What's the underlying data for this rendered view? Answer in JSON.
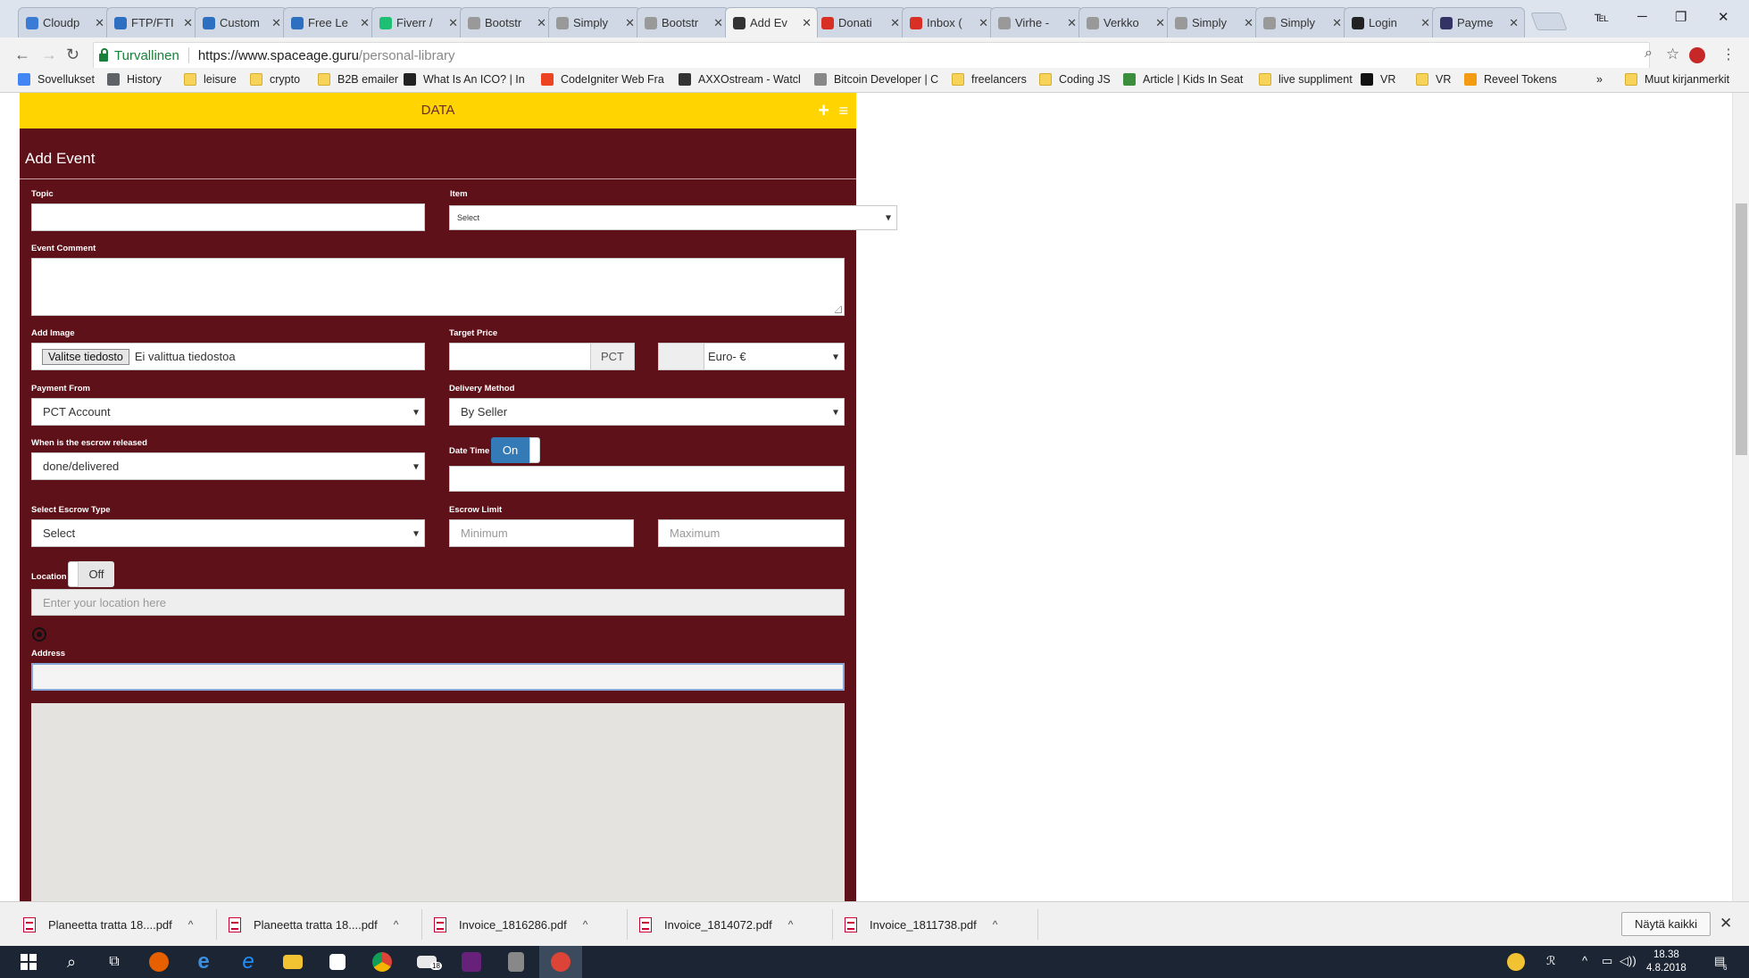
{
  "browser": {
    "tabs": [
      {
        "label": "Cloudp",
        "icon": "cloud-icon",
        "color": "#3a7bd5"
      },
      {
        "label": "FTP/FTI",
        "icon": "filezilla-icon",
        "color": "#2d6fc0"
      },
      {
        "label": "Custom",
        "icon": "filezilla-icon",
        "color": "#2d6fc0"
      },
      {
        "label": "Free Le",
        "icon": "filezilla-icon",
        "color": "#2d6fc0"
      },
      {
        "label": "Fiverr /",
        "icon": "fiverr-icon",
        "color": "#1dbf73"
      },
      {
        "label": "Bootstr",
        "icon": "page-icon",
        "color": "#999999"
      },
      {
        "label": "Simply",
        "icon": "page-icon",
        "color": "#999999"
      },
      {
        "label": "Bootstr",
        "icon": "page-icon",
        "color": "#999999"
      },
      {
        "label": "Add Ev",
        "icon": "site-icon",
        "color": "#333333",
        "active": true
      },
      {
        "label": "Donati",
        "icon": "gmail-icon",
        "color": "#d93025"
      },
      {
        "label": "Inbox (",
        "icon": "gmail-icon",
        "color": "#d93025"
      },
      {
        "label": "Virhe -",
        "icon": "page-icon",
        "color": "#999999"
      },
      {
        "label": "Verkko",
        "icon": "page-icon",
        "color": "#999999"
      },
      {
        "label": "Simply",
        "icon": "page-icon",
        "color": "#999999"
      },
      {
        "label": "Simply",
        "icon": "page-icon",
        "color": "#999999"
      },
      {
        "label": "Login",
        "icon": "github-icon",
        "color": "#222222"
      },
      {
        "label": "Payme",
        "icon": "payment-icon",
        "color": "#333366"
      }
    ],
    "secure_label": "Turvallinen",
    "url_host": "https://www.spaceage.guru",
    "url_path": "/personal-library",
    "bookmarks": [
      {
        "label": "Sovellukset",
        "icon": "apps-icon"
      },
      {
        "label": "History",
        "icon": "history-icon"
      },
      {
        "label": "leisure",
        "icon": "folder-icon"
      },
      {
        "label": "crypto",
        "icon": "folder-icon"
      },
      {
        "label": "B2B emailer",
        "icon": "folder-icon"
      },
      {
        "label": "What Is An ICO? | In",
        "icon": "info-icon"
      },
      {
        "label": "CodeIgniter Web Fra",
        "icon": "codeigniter-icon"
      },
      {
        "label": "AXXOstream - Watcl",
        "icon": "video-icon"
      },
      {
        "label": "Bitcoin Developer | C",
        "icon": "bitcoin-icon"
      },
      {
        "label": "freelancers",
        "icon": "folder-icon"
      },
      {
        "label": "Coding JS",
        "icon": "folder-icon"
      },
      {
        "label": "Article | Kids In Seat",
        "icon": "kids-icon"
      },
      {
        "label": "live suppliment",
        "icon": "folder-icon"
      },
      {
        "label": "VR",
        "icon": "vr-icon"
      },
      {
        "label": "VR",
        "icon": "folder-icon"
      },
      {
        "label": "Reveel Tokens",
        "icon": "reveel-icon"
      }
    ],
    "more_bookmarks": "»",
    "other_bookmarks": "Muut kirjanmerkit"
  },
  "page": {
    "header_title": "DATA",
    "form_title": "Add Event",
    "labels": {
      "topic": "Topic",
      "item": "Item",
      "event_comment": "Event Comment",
      "add_image": "Add Image",
      "target_price": "Target Price",
      "payment_from": "Payment From",
      "delivery_method": "Delivery Method",
      "escrow_release": "When is the escrow released",
      "date_time": "Date Time",
      "escrow_type": "Select Escrow Type",
      "escrow_limit": "Escrow Limit",
      "location": "Location",
      "address": "Address"
    },
    "values": {
      "topic": "",
      "item": "Select",
      "event_comment": "",
      "file_button": "Valitse tiedosto",
      "file_status": "Ei valittua tiedostoa",
      "target_price": "",
      "price_unit": "PCT",
      "currency": "Euro- €",
      "payment_from": "PCT Account",
      "delivery_method": "By Seller",
      "escrow_release": "done/delivered",
      "date_time_toggle": "On",
      "date_time": "",
      "escrow_type": "Select",
      "escrow_min_placeholder": "Minimum",
      "escrow_max_placeholder": "Maximum",
      "location_toggle": "Off",
      "location_placeholder": "Enter your location here",
      "address": ""
    }
  },
  "downloads": {
    "items": [
      "Planeetta tratta 18....pdf",
      "Planeetta tratta 18....pdf",
      "Invoice_1816286.pdf",
      "Invoice_1814072.pdf",
      "Invoice_1811738.pdf"
    ],
    "show_all": "Näytä kaikki"
  },
  "taskbar": {
    "apps": [
      "windows-start-icon",
      "search-icon",
      "task-view-icon",
      "firefox-icon",
      "edge-icon",
      "ie-icon",
      "file-explorer-icon",
      "store-icon",
      "chrome-icon",
      "mail-icon",
      "visual-studio-icon",
      "calculator-icon",
      "chrome-active-icon"
    ],
    "mail_badge": "18",
    "time": "18.38",
    "date": "4.8.2018",
    "notification_count": "6"
  },
  "colors": {
    "panel": "#5e1119",
    "header_bar": "#ffd400",
    "toggle_on": "#337ab7"
  }
}
